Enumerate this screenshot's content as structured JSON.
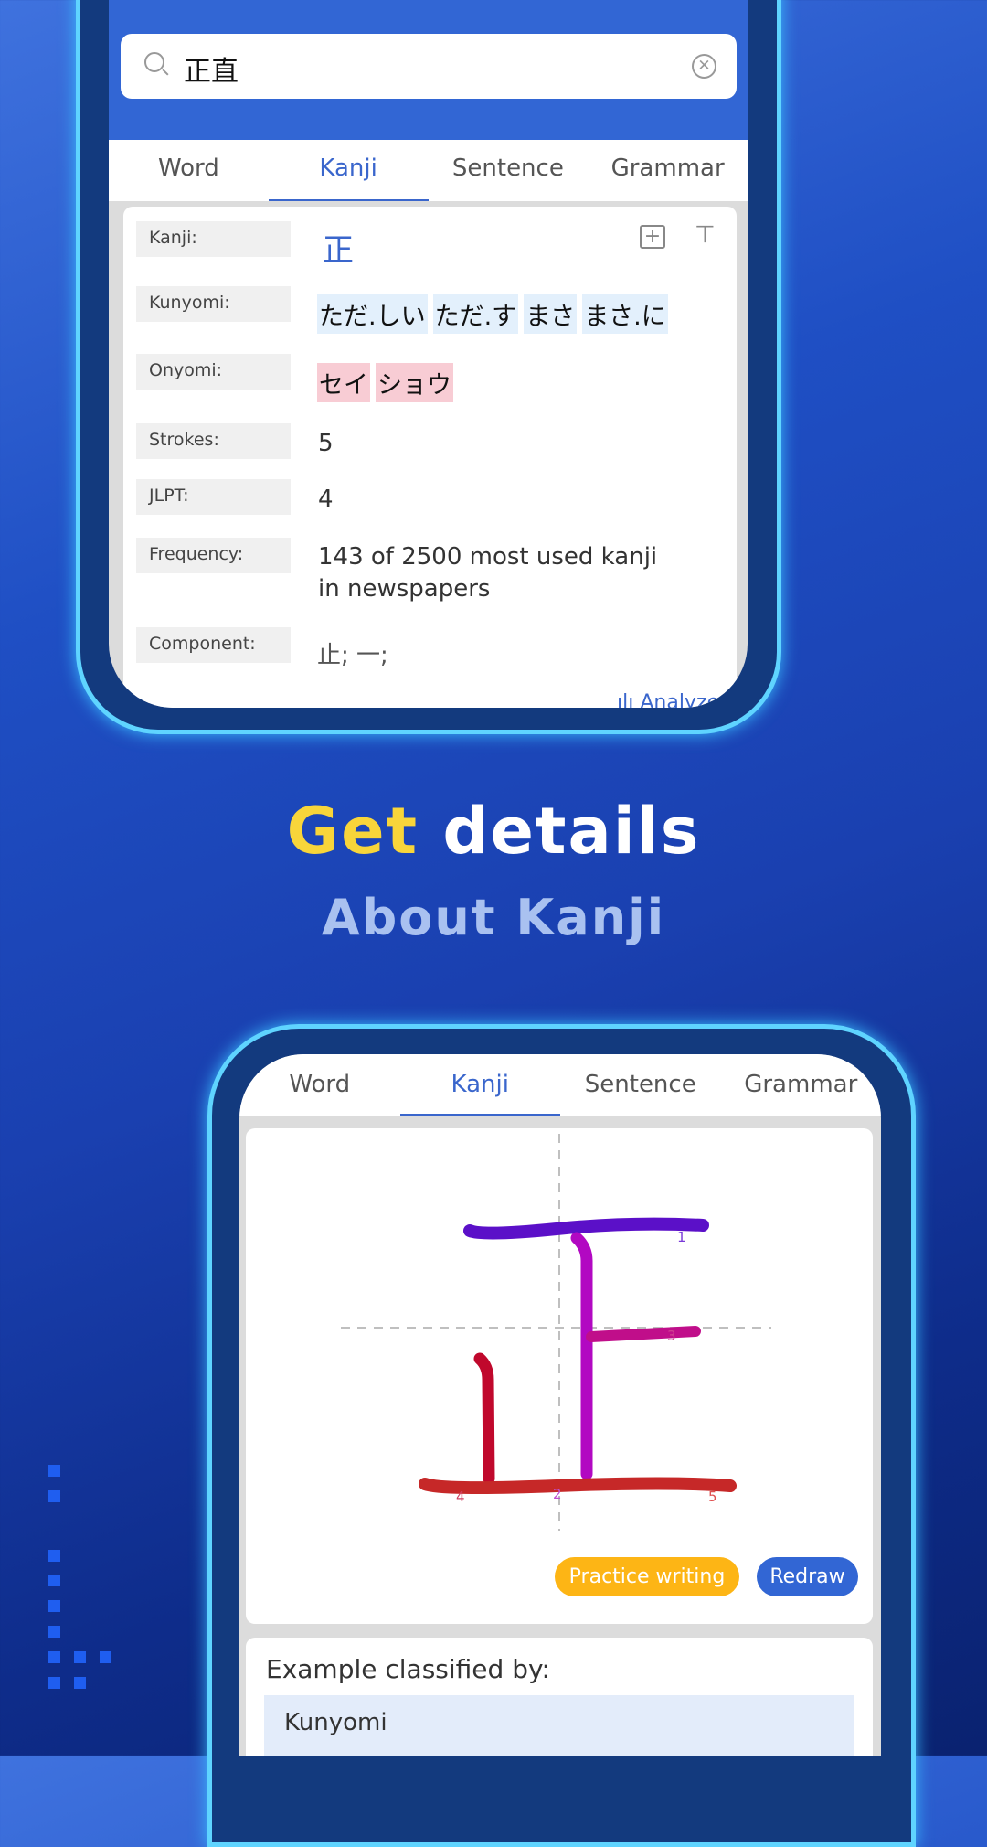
{
  "top_phone": {
    "search": {
      "value": "正直",
      "icon": "search-icon",
      "clear_icon": "clear-icon"
    },
    "tabs": [
      "Word",
      "Kanji",
      "Sentence",
      "Grammar"
    ],
    "active_tab": "Kanji",
    "details": {
      "kanji_label": "Kanji:",
      "kanji": "正",
      "kunyomi_label": "Kunyomi:",
      "kunyomi": [
        "ただ.しい",
        "ただ.す",
        "まさ",
        "まさ.に"
      ],
      "onyomi_label": "Onyomi:",
      "onyomi": [
        "セイ",
        "ショウ"
      ],
      "strokes_label": "Strokes:",
      "strokes": "5",
      "jlpt_label": "JLPT:",
      "jlpt": "4",
      "frequency_label": "Frequency:",
      "frequency_line1": "143 of 2500 most used kanji",
      "frequency_line2": "in newspapers",
      "component_label": "Component:",
      "component": "止; 一;",
      "analyze": "Analyze"
    }
  },
  "headline": {
    "highlight": "Get",
    "rest": "details",
    "subtitle": "About Kanji"
  },
  "bottom_phone": {
    "tabs": [
      "Word",
      "Kanji",
      "Sentence",
      "Grammar"
    ],
    "active_tab": "Kanji",
    "stroke_numbers": [
      "1",
      "2",
      "3",
      "4",
      "5"
    ],
    "practice_label": "Practice writing",
    "redraw_label": "Redraw",
    "example_title": "Example classified by:",
    "example_option": "Kunyomi"
  },
  "colors": {
    "accent": "#3266d4",
    "highlight": "#f8d53a",
    "practice": "#fdb515",
    "redraw": "#3266d4"
  }
}
